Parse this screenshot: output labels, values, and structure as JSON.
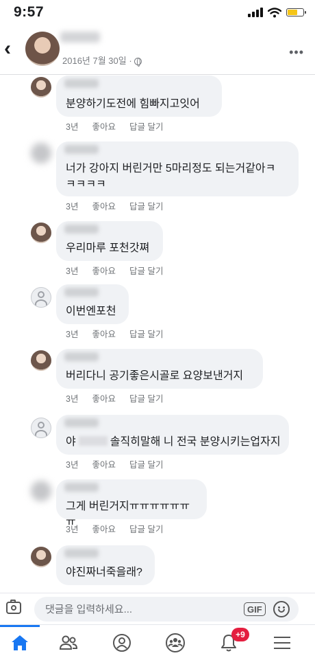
{
  "status_bar": {
    "time": "9:57",
    "icons": [
      "signal-icon",
      "wifi-icon",
      "battery-icon"
    ]
  },
  "header": {
    "back_icon": "chevron-left-icon",
    "date": "2016년 7월 30일 ·",
    "privacy_icon": "globe-icon",
    "more_icon": "more-horizontal-icon"
  },
  "action_labels": {
    "like": "좋아요",
    "reply": "답글 달기"
  },
  "comments": [
    {
      "avatar": "photo",
      "lines": [
        "분양하기도전에 힘빠지고잇어"
      ],
      "time": "3년"
    },
    {
      "avatar": "blurred",
      "lines": [
        "너가 강아지 버린거만 5마리정도 되는거같아ㅋ",
        "ㅋㅋㅋㅋ"
      ],
      "time": "3년"
    },
    {
      "avatar": "photo",
      "lines": [
        "우리마루 포천갓쪄"
      ],
      "time": "3년"
    },
    {
      "avatar": "default",
      "lines": [
        "이번엔포천"
      ],
      "time": "3년"
    },
    {
      "avatar": "photo",
      "lines": [
        "버리다니 공기좋은시골로 요양보낸거지"
      ],
      "time": "3년"
    },
    {
      "avatar": "default",
      "lines": [
        "솔직히말해 니 전국 분양시키는업자지"
      ],
      "prefix": "야",
      "time": "3년"
    },
    {
      "avatar": "blurred",
      "lines": [
        "그게 버린거지ㅠㅠㅠㅠㅠㅠㅠ"
      ],
      "time": "3년"
    },
    {
      "avatar": "photo",
      "lines": [
        "야진짜너죽을래?"
      ],
      "time": ""
    }
  ],
  "composer": {
    "placeholder": "댓글을 입력하세요...",
    "gif_label": "GIF",
    "camera_icon": "camera-icon",
    "emoji_icon": "smiley-icon"
  },
  "tab_bar": {
    "items": [
      "home-icon",
      "friends-icon",
      "profile-icon",
      "groups-icon",
      "notifications-icon",
      "menu-icon"
    ],
    "notification_badge": "+9",
    "active_color": "#1877f2",
    "badge_color": "#e41e3f"
  }
}
